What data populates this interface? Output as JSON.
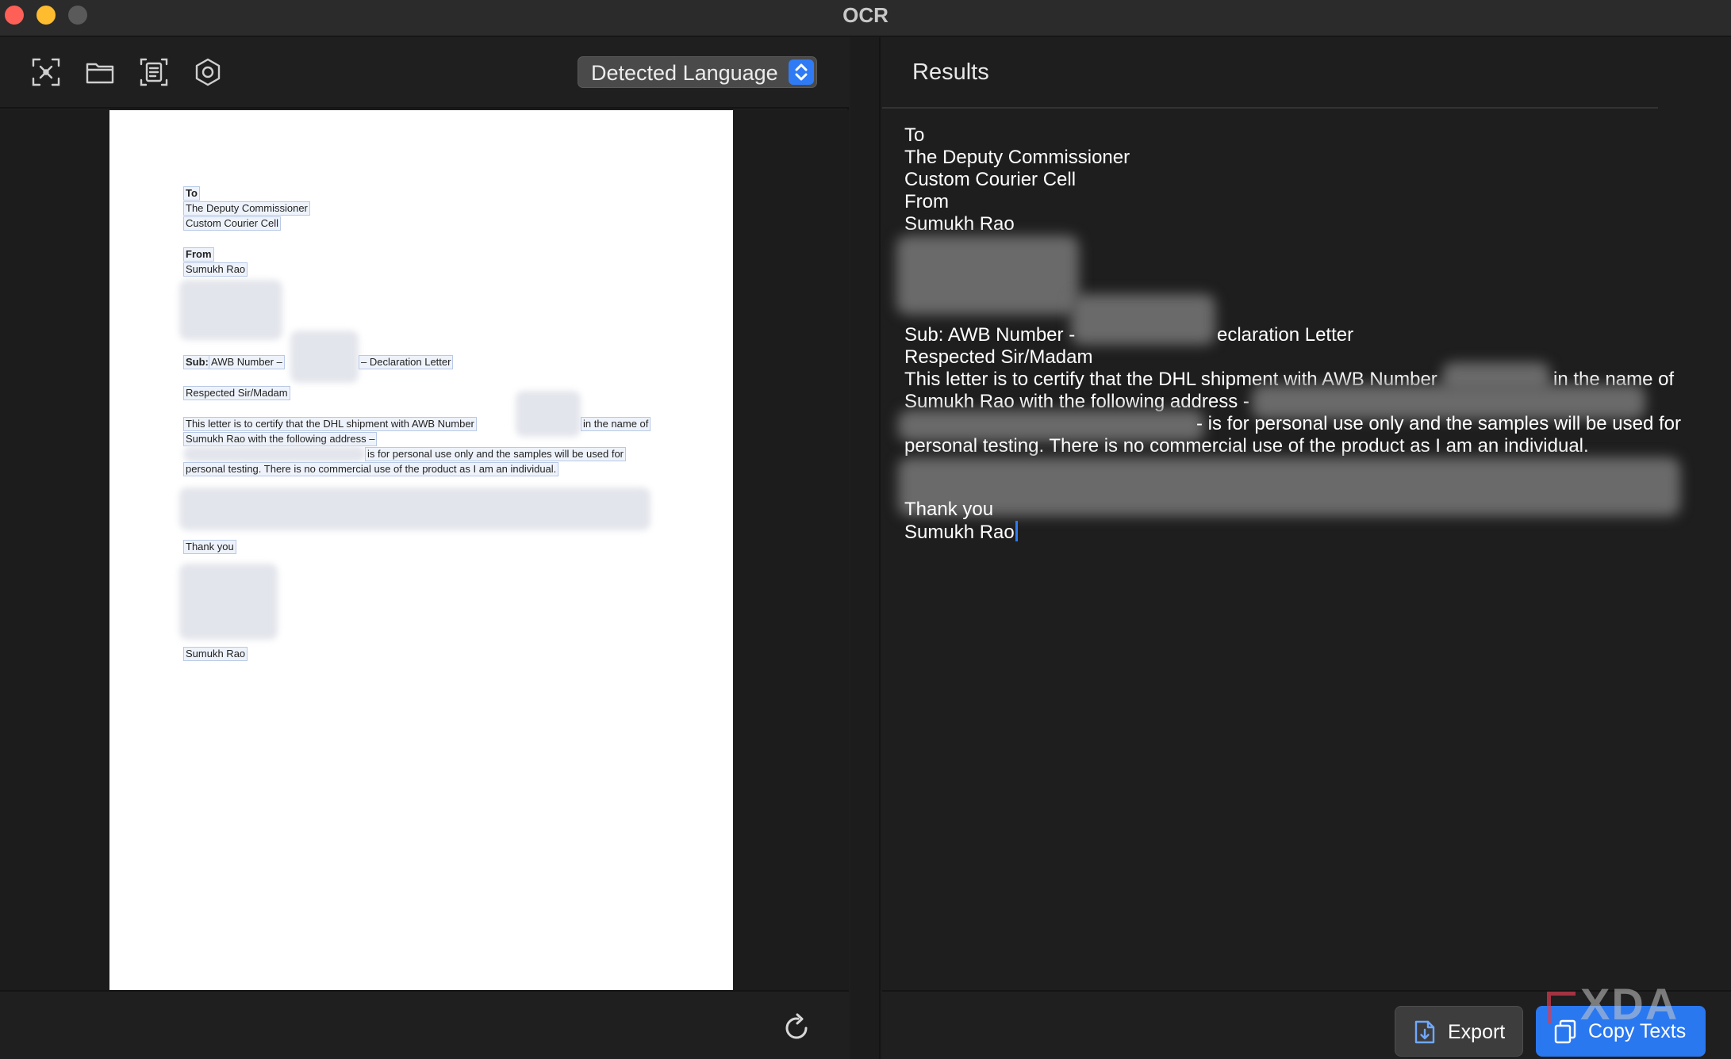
{
  "window": {
    "title": "OCR"
  },
  "toolbar": {
    "icons": [
      "capture-icon",
      "folder-icon",
      "document-scan-icon",
      "settings-icon"
    ],
    "language_select": "Detected Language"
  },
  "document": {
    "lines": {
      "to": "To",
      "deputy": "The Deputy Commissioner",
      "cell": "Custom Courier Cell",
      "from": "From",
      "name": "Sumukh Rao",
      "sub_bold": "Sub:",
      "sub_text": "AWB Number –",
      "declaration": "– Declaration Letter",
      "greeting": "Respected Sir/Madam",
      "body1": "This letter is to certify that the DHL shipment with AWB Number",
      "body1b": "in the name of",
      "body2": "Sumukh Rao with the following address –",
      "body3": "is for personal use only and the samples will be used for",
      "body4": "personal testing. There is no commercial use of the product as I am an individual.",
      "thanks": "Thank you",
      "signoff": "Sumukh Rao"
    }
  },
  "results": {
    "title": "Results",
    "lines": {
      "l1": "To",
      "l2": "The Deputy Commissioner",
      "l3": "Custom Courier Cell",
      "l4": "From",
      "l5": "Sumukh Rao",
      "l6a": "Sub: AWB Number -",
      "l6b": "eclaration Letter",
      "l7": "Respected Sir/Madam",
      "l8a": "This letter is to certify that the DHL shipment with AWB Number",
      "l8b": "in the name of",
      "l9": "Sumukh Rao with the following address -",
      "l10": "- is for personal use only and the samples will be used for",
      "l11": "personal testing. There is no commercial use of the product as I am an individual.",
      "l12": "Thank you",
      "l13": "Sumukh Rao"
    }
  },
  "footer": {
    "export_label": "Export",
    "copy_label": "Copy Texts"
  },
  "watermark": "XDA"
}
